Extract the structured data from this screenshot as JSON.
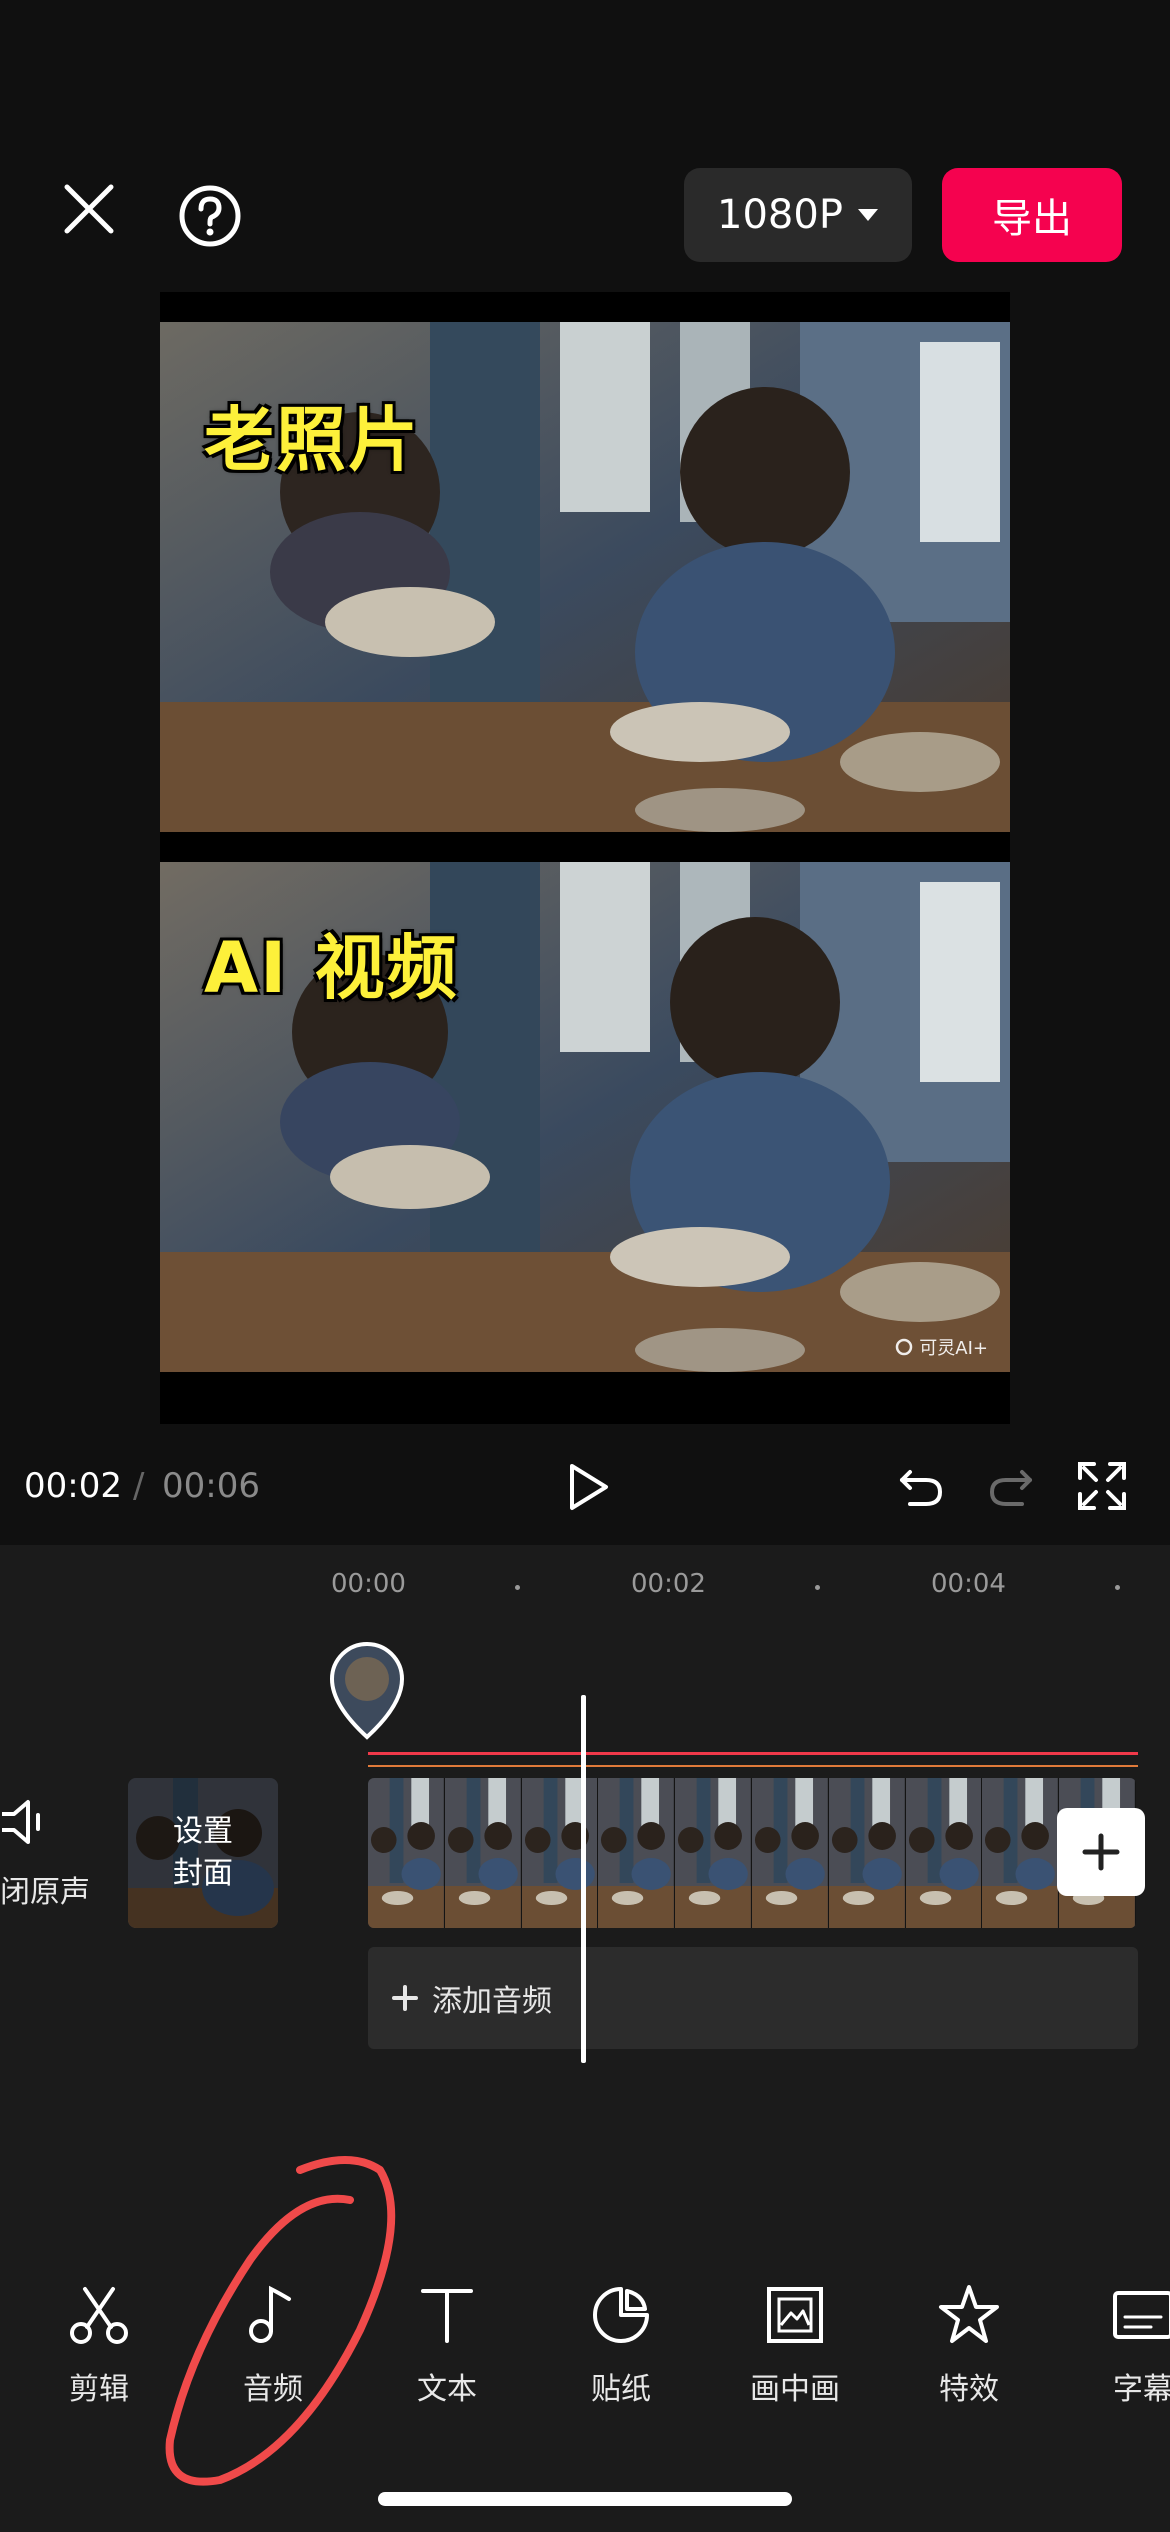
{
  "header": {
    "resolution_label": "1080P",
    "export_label": "导出",
    "close_icon": "close-icon",
    "help_icon": "help-icon"
  },
  "preview": {
    "top_caption": "老照片",
    "bottom_caption": "AI 视频",
    "watermark": "可灵AI+"
  },
  "playback": {
    "current_time": "00:02",
    "separator": "/",
    "total_time": "00:06"
  },
  "timeline": {
    "ruler": [
      "00:00",
      "00:02",
      "00:04"
    ],
    "mute_label": "闭原声",
    "cover_line1": "设置",
    "cover_line2": "封面",
    "add_audio_label": "添加音频",
    "add_clip_icon": "plus-icon"
  },
  "toolbar": {
    "items": [
      {
        "label": "剪辑",
        "icon": "scissors-icon"
      },
      {
        "label": "音频",
        "icon": "music-note-icon"
      },
      {
        "label": "文本",
        "icon": "text-icon"
      },
      {
        "label": "贴纸",
        "icon": "sticker-icon"
      },
      {
        "label": "画中画",
        "icon": "picture-in-picture-icon"
      },
      {
        "label": "特效",
        "icon": "effects-star-icon"
      },
      {
        "label": "字幕",
        "icon": "subtitle-icon"
      }
    ]
  },
  "colors": {
    "accent": "#f5024f",
    "caption_yellow": "#fdf03a",
    "annotation_red": "#f04a4a",
    "background": "#101010",
    "panel": "#1b1b1b"
  }
}
